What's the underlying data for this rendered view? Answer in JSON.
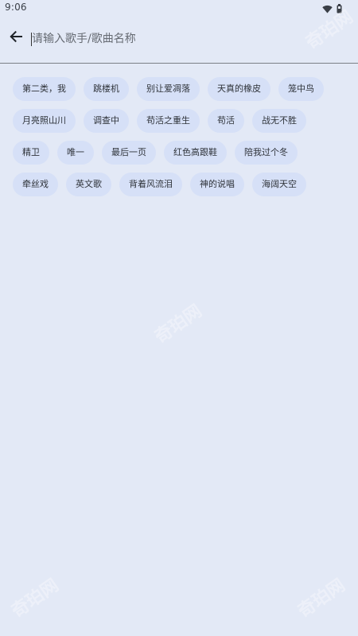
{
  "status_bar": {
    "time": "9:06",
    "icons": [
      "wifi-icon",
      "battery-icon"
    ]
  },
  "search": {
    "back_icon": "arrow-left-icon",
    "placeholder": "请输入歌手/歌曲名称",
    "value": ""
  },
  "tags": [
    [
      "第二类，我",
      "跳楼机",
      "别让爱凋落",
      "天真的橡皮",
      "笼中鸟"
    ],
    [
      "月亮照山川",
      "调查中",
      "苟活之重生",
      "苟活",
      "战无不胜"
    ],
    [
      "精卫",
      "唯一",
      "最后一页",
      "红色高跟鞋",
      "陪我过个冬"
    ],
    [
      "牵丝戏",
      "英文歌",
      "背着风流泪",
      "神的说唱",
      "海阔天空"
    ]
  ],
  "watermark": "奇珀网",
  "colors": {
    "background": "#e3e9f6",
    "tag_background": "#d6e0f7",
    "text": "#2f333a"
  }
}
